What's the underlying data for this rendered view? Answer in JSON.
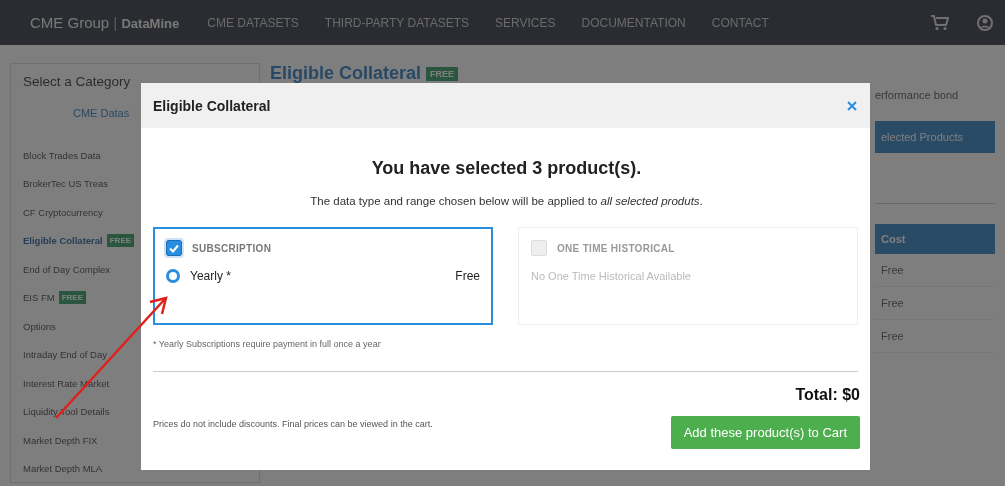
{
  "nav": {
    "logo": "CME Group",
    "separator": "|",
    "product": "DataMine",
    "links": [
      "CME DATASETS",
      "THIRD-PARTY DATASETS",
      "SERVICES",
      "DOCUMENTATION",
      "CONTACT"
    ]
  },
  "sidebar": {
    "title": "Select a Category",
    "tab": "CME Datas",
    "items": [
      {
        "label": "Block Trades Data",
        "selected": false
      },
      {
        "label": "BrokerTec US Treas",
        "selected": false
      },
      {
        "label": "CF Cryptocurrency",
        "selected": false
      },
      {
        "label": "Eligible Collateral",
        "selected": true,
        "badge": "FREE"
      },
      {
        "label": "End of Day Complex",
        "selected": false
      },
      {
        "label": "EIS FM",
        "selected": false,
        "badge": "FREE"
      },
      {
        "label": "Options",
        "selected": false
      },
      {
        "label": "Intraday End of Day",
        "selected": false
      },
      {
        "label": "Interest Rate Market",
        "selected": false
      },
      {
        "label": "Liquidity Tool Details",
        "selected": false
      },
      {
        "label": "Market Depth FIX",
        "selected": false
      },
      {
        "label": "Market Depth MLA",
        "selected": false
      }
    ]
  },
  "main": {
    "title": "Eligible Collateral",
    "badge": "FREE",
    "note": "erformance bond",
    "selected_button": "elected Products",
    "cost_header": "Cost",
    "costs": [
      "Free",
      "Free",
      "Free"
    ]
  },
  "modal": {
    "title": "Eligible Collateral",
    "heading": "You have selected 3 product(s).",
    "subtext": "The data type and range chosen below will be applied to *all selected produts*.",
    "options": [
      {
        "kind": "plans",
        "label": "SUBSCRIPTION",
        "checked": true,
        "disabled": false,
        "plans": [
          {
            "label": "Yearly *",
            "price": "Free",
            "selected": true
          }
        ]
      },
      {
        "kind": "empty",
        "label": "ONE TIME HISTORICAL",
        "checked": false,
        "disabled": true,
        "empty_text": "No One Time Historical Available"
      }
    ],
    "footnote": "* Yearly Subscriptions require payment in full once a year",
    "total": "Total: $0",
    "disclaimer": "Prices do not include discounts. Final prices can be viewed in the cart.",
    "button": "Add these product(s) to Cart"
  }
}
